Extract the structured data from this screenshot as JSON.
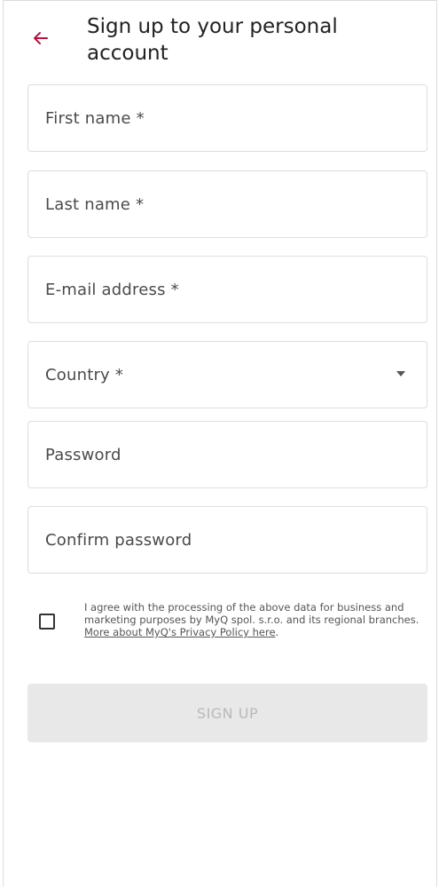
{
  "header": {
    "title": "Sign up to your personal account"
  },
  "form": {
    "first_name": {
      "placeholder": "First name *"
    },
    "last_name": {
      "placeholder": "Last name *"
    },
    "email": {
      "placeholder": "E-mail address *"
    },
    "country": {
      "placeholder": "Country *"
    },
    "password": {
      "placeholder": "Password"
    },
    "confirm_password": {
      "placeholder": "Confirm password"
    }
  },
  "consent": {
    "text": "I agree with the processing of the above data for business and marketing purposes by MyQ spol. s.r.o. and its regional branches. ",
    "link": "More about MyQ's Privacy Policy here",
    "after": ".",
    "checked": false
  },
  "actions": {
    "signup_label": "SIGN UP"
  },
  "colors": {
    "accent": "#b5153f",
    "button_bg": "#e8e8e8",
    "button_text": "#b9b9b9"
  }
}
